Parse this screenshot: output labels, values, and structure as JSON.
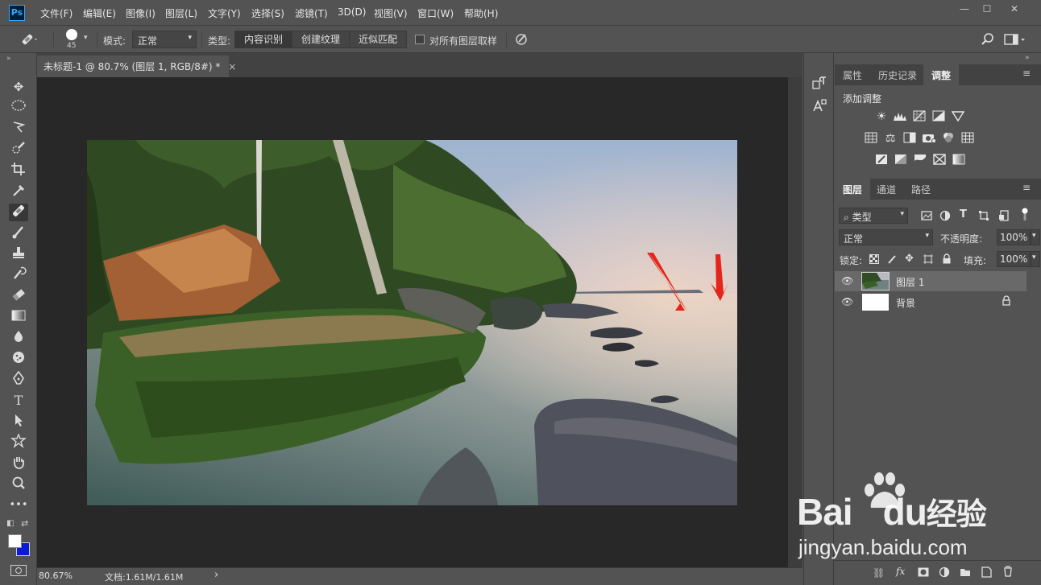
{
  "app": {
    "logo": "Ps"
  },
  "menu": [
    "文件(F)",
    "编辑(E)",
    "图像(I)",
    "图层(L)",
    "文字(Y)",
    "选择(S)",
    "滤镜(T)",
    "3D(D)",
    "视图(V)",
    "窗口(W)",
    "帮助(H)"
  ],
  "window": {
    "minimize": "—",
    "restore": "☐",
    "close": "✕"
  },
  "options": {
    "brush_size": "45",
    "mode_label": "模式:",
    "mode_value": "正常",
    "type_label": "类型:",
    "type_options": [
      "内容识别",
      "创建纹理",
      "近似匹配"
    ],
    "sample_all_layers": "对所有图层取样"
  },
  "document": {
    "tab_title": "未标题-1 @ 80.7% (图层 1, RGB/8#) *",
    "tab_close": "×"
  },
  "status": {
    "zoom": "80.67%",
    "doc_info": "文档:1.61M/1.61M",
    "arrow": "›"
  },
  "panels": {
    "top_tabs": [
      "属性",
      "历史记录",
      "调整"
    ],
    "add_adjustment": "添加调整",
    "layer_tabs": [
      "图层",
      "通道",
      "路径"
    ],
    "kind_filter": "类型",
    "blend_mode": "正常",
    "opacity_label": "不透明度:",
    "opacity_value": "100%",
    "lock_label": "锁定:",
    "fill_label": "填充:",
    "fill_value": "100%",
    "layers": [
      {
        "name": "图层 1",
        "selected": true
      },
      {
        "name": "背景",
        "selected": false
      }
    ]
  },
  "watermark": {
    "brand": "Bai",
    "brand2": "du",
    "cn": "经验",
    "url": "jingyan.baidu.com"
  },
  "colors": {
    "accent": "#31a8ff",
    "foreground": "#ffffff",
    "background": "#0a1ad6"
  }
}
